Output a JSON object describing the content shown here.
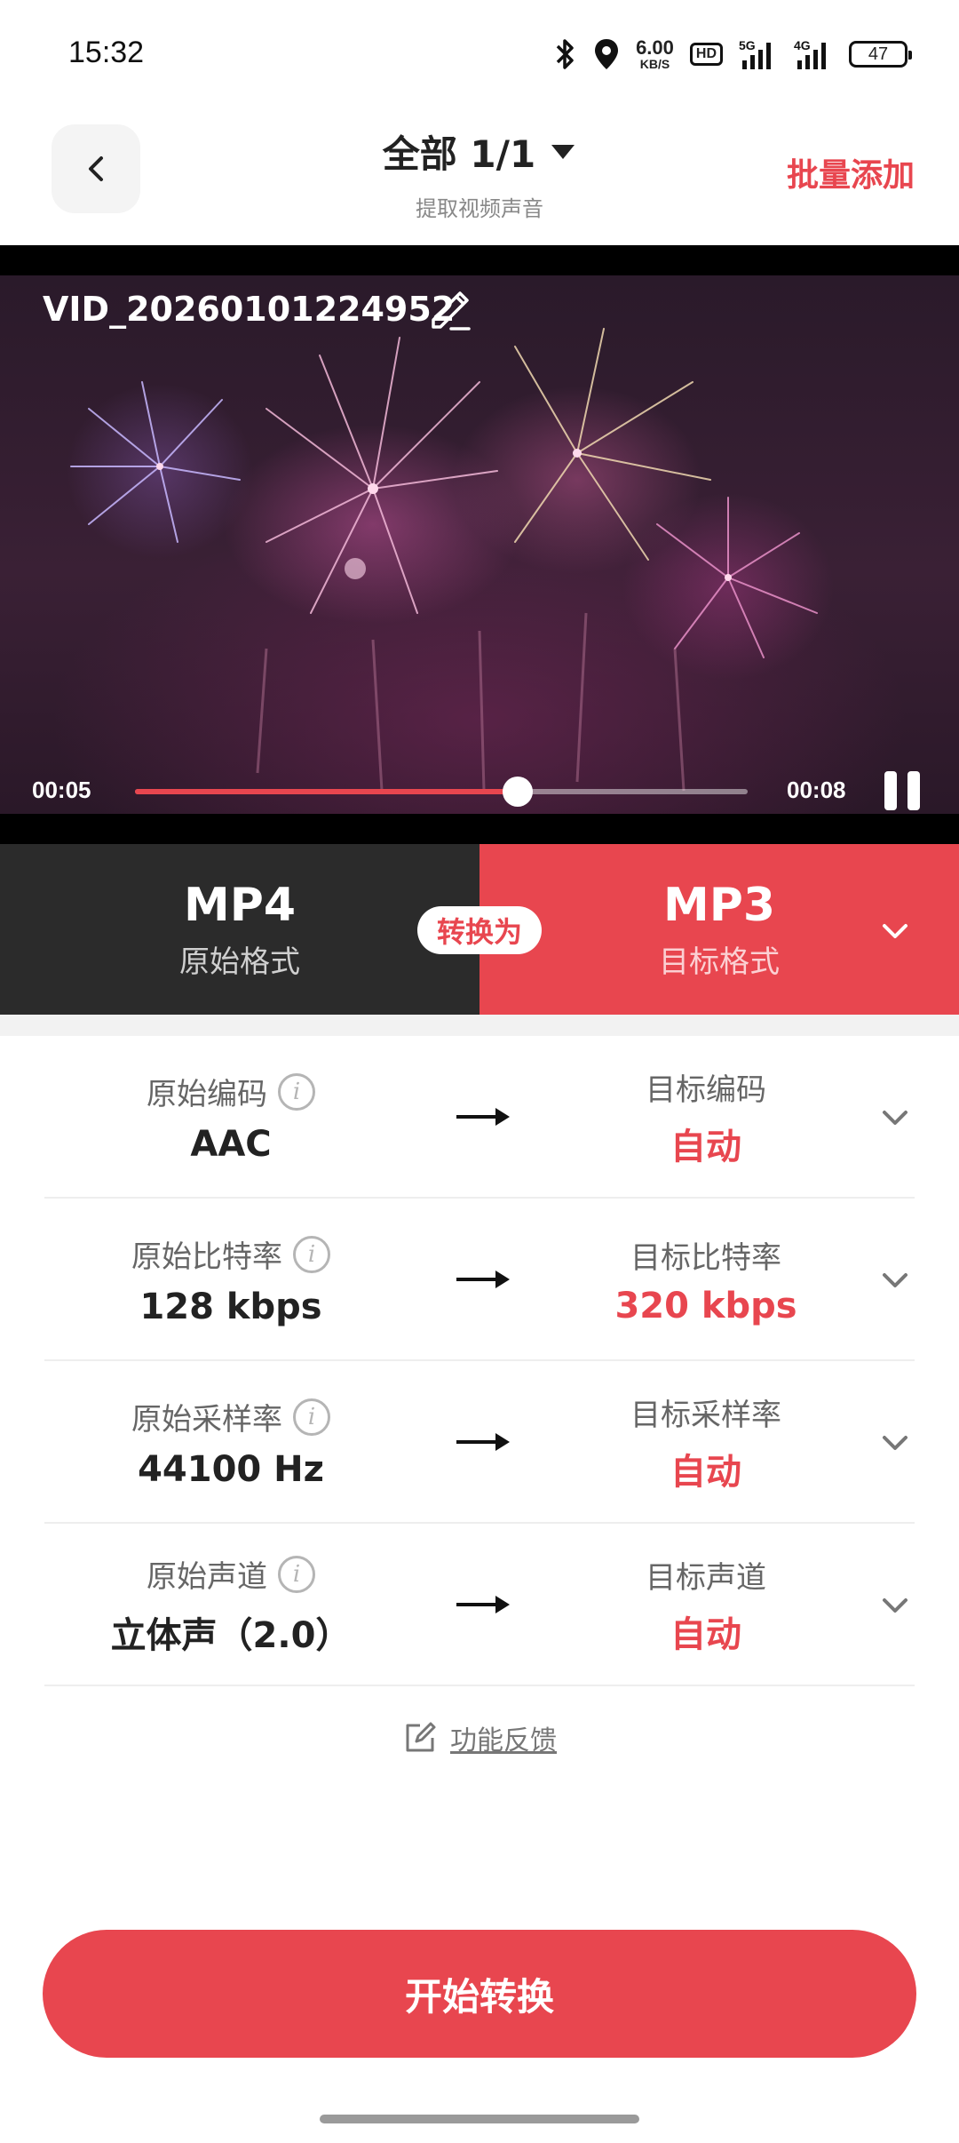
{
  "status_bar": {
    "time": "15:32",
    "net_speed_value": "6.00",
    "net_speed_unit": "KB/S",
    "hd_label": "HD",
    "signal_1_label": "5G",
    "signal_2_label": "4G",
    "battery_level": "47",
    "icons": [
      "bluetooth-icon",
      "location-icon",
      "hd-icon",
      "signal-5g-icon",
      "signal-4g-icon",
      "battery-icon"
    ]
  },
  "header": {
    "title": "全部 1/1",
    "subtitle": "提取视频声音",
    "batch_add_label": "批量添加",
    "icons": [
      "back-arrow-icon",
      "dropdown-triangle-icon"
    ]
  },
  "video": {
    "filename": "VID_20260101224952",
    "current_time": "00:05",
    "total_time": "00:08",
    "progress_fraction": 0.625,
    "icons": [
      "edit-pencil-icon",
      "pause-icon"
    ]
  },
  "format": {
    "source_name": "MP4",
    "source_sub": "原始格式",
    "convert_label": "转换为",
    "target_name": "MP3",
    "target_sub": "目标格式"
  },
  "params": [
    {
      "src_label": "原始编码",
      "src_value": "AAC",
      "tgt_label": "目标编码",
      "tgt_value": "自动"
    },
    {
      "src_label": "原始比特率",
      "src_value": "128 kbps",
      "tgt_label": "目标比特率",
      "tgt_value": "320 kbps"
    },
    {
      "src_label": "原始采样率",
      "src_value": "44100 Hz",
      "tgt_label": "目标采样率",
      "tgt_value": "自动"
    },
    {
      "src_label": "原始声道",
      "src_value": "立体声（2.0）",
      "tgt_label": "目标声道",
      "tgt_value": "自动"
    }
  ],
  "feedback_label": "功能反馈",
  "start_button_label": "开始转换",
  "colors": {
    "accent": "#e8464f",
    "dark_panel": "#2b2b2b",
    "background": "#ffffff"
  }
}
